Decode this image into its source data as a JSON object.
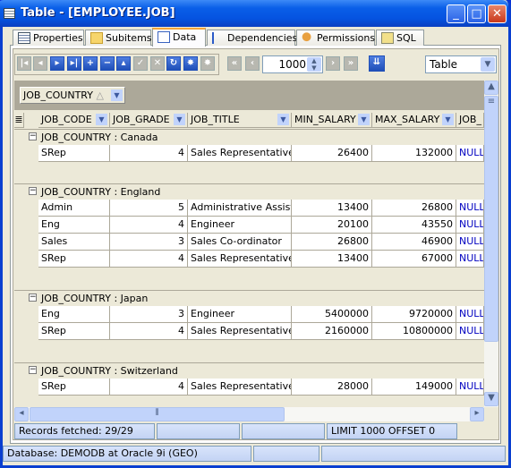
{
  "window": {
    "title": "Table - [EMPLOYEE.JOB]",
    "min": "_",
    "max": "□",
    "close": "✕"
  },
  "tabs": [
    {
      "label": "Properties"
    },
    {
      "label": "Subitems"
    },
    {
      "label": "Data",
      "active": true
    },
    {
      "label": "Dependencies"
    },
    {
      "label": "Permissions"
    },
    {
      "label": "SQL"
    }
  ],
  "toolbar": {
    "record_limit": "1000",
    "view_mode": "Table"
  },
  "grouping": {
    "field": "JOB_COUNTRY",
    "sort": "△"
  },
  "columns": [
    "JOB_CODE",
    "JOB_GRADE",
    "JOB_TITLE",
    "MIN_SALARY",
    "MAX_SALARY",
    "JOB_"
  ],
  "groups": [
    {
      "label": "JOB_COUNTRY : Canada",
      "rows": [
        [
          "SRep",
          "4",
          "Sales Representative",
          "26400",
          "132000",
          "NULL"
        ]
      ]
    },
    {
      "label": "JOB_COUNTRY : England",
      "rows": [
        [
          "Admin",
          "5",
          "Administrative Assistant",
          "13400",
          "26800",
          "NULL"
        ],
        [
          "Eng",
          "4",
          "Engineer",
          "20100",
          "43550",
          "NULL"
        ],
        [
          "Sales",
          "3",
          "Sales Co-ordinator",
          "26800",
          "46900",
          "NULL"
        ],
        [
          "SRep",
          "4",
          "Sales Representative",
          "13400",
          "67000",
          "NULL"
        ]
      ]
    },
    {
      "label": "JOB_COUNTRY : Japan",
      "rows": [
        [
          "Eng",
          "3",
          "Engineer",
          "5400000",
          "9720000",
          "NULL"
        ],
        [
          "SRep",
          "4",
          "Sales Representative",
          "2160000",
          "10800000",
          "NULL"
        ]
      ]
    },
    {
      "label": "JOB_COUNTRY : Switzerland",
      "rows": [
        [
          "SRep",
          "4",
          "Sales Representative",
          "28000",
          "149000",
          "NULL"
        ]
      ]
    }
  ],
  "status": {
    "records": "Records fetched: 29/29",
    "limit": "LIMIT 1000 OFFSET 0",
    "database": "Database: DEMODB  at Oracle 9i (GEO)"
  }
}
